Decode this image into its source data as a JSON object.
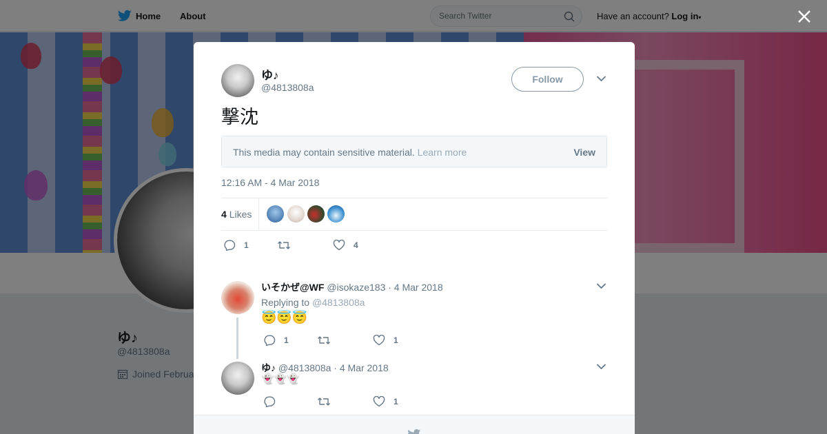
{
  "topbar": {
    "home_label": "Home",
    "about_label": "About",
    "search_placeholder": "Search Twitter",
    "have_account": "Have an account?",
    "login_label": "Log in",
    "login_caret": "▾"
  },
  "profile": {
    "name": "ゆ♪",
    "handle": "@4813808a",
    "joined": "Joined Februa"
  },
  "tweet": {
    "author_name": "ゆ♪",
    "author_handle": "@4813808a",
    "follow_label": "Follow",
    "text": "撃沈",
    "sensitive_message": "This media may contain sensitive material.",
    "learn_more": "Learn more",
    "view_label": "View",
    "timestamp": "12:16 AM - 4 Mar 2018",
    "likes_count": "4",
    "likes_label": "Likes",
    "reply_count": "1",
    "retweet_count": "",
    "like_count": "4"
  },
  "replies": [
    {
      "name": "いそかぜ@WF",
      "handle": "@isokaze183",
      "date": "· 4 Mar 2018",
      "replying_prefix": "Replying to",
      "replying_to": "@4813808a",
      "text": "😇😇😇",
      "reply_count": "1",
      "retweet_count": "",
      "like_count": "1"
    },
    {
      "name": "ゆ♪",
      "handle": "@4813808a",
      "date": "· 4 Mar 2018",
      "text": "👻👻👻",
      "reply_count": "",
      "retweet_count": "",
      "like_count": "1"
    }
  ],
  "colors": {
    "twitter_blue": "#1da1f2",
    "muted_text": "#657786",
    "border": "#e6ecf0"
  }
}
